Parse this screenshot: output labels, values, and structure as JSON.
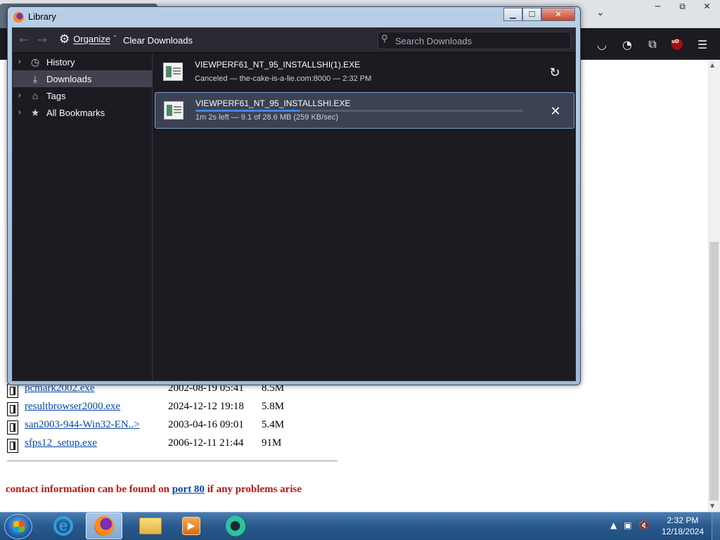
{
  "library": {
    "title": "Library",
    "window_controls": {
      "minimize": "▁",
      "maximize": "☐",
      "close": "✕"
    },
    "toolbar": {
      "back_icon": "←",
      "forward_icon": "→",
      "organize_label": "Organize",
      "organize_icon": "⚙",
      "organize_chevron": "ˇ",
      "clear_downloads_label": "Clear Downloads",
      "search_placeholder": "Search Downloads",
      "search_icon": "⚲"
    },
    "sidebar": {
      "items": [
        {
          "label": "History",
          "icon": "clock-icon",
          "glyph": "◷",
          "chevron": "›",
          "selected": false
        },
        {
          "label": "Downloads",
          "icon": "download-icon",
          "glyph": "⤓",
          "chevron": "",
          "selected": true
        },
        {
          "label": "Tags",
          "icon": "tag-icon",
          "glyph": "⌂",
          "chevron": "›",
          "selected": false
        },
        {
          "label": "All Bookmarks",
          "icon": "star-icon",
          "glyph": "★",
          "chevron": "›",
          "selected": false
        }
      ]
    },
    "downloads": [
      {
        "name": "VIEWPERF61_NT_95_INSTALLSHI(1).EXE",
        "status": "Canceled — the-cake-is-a-lie.com:8000 — 2:32 PM",
        "action_icon": "↻",
        "action": "retry",
        "progress": null
      },
      {
        "name": "VIEWPERF61_NT_95_INSTALLSHI.EXE",
        "status": "1m 2s left — 9.1 of 28.6 MB (259 KB/sec)",
        "action_icon": "✕",
        "action": "cancel",
        "progress": 0.32
      }
    ]
  },
  "page": {
    "files": [
      {
        "name": "pcmark2002.exe",
        "date": "2002-08-19 05:41",
        "size": "8.5M"
      },
      {
        "name": "resultbrowser2000.exe",
        "date": "2024-12-12 19:18",
        "size": "5.8M"
      },
      {
        "name": "san2003-944-Win32-EN..>",
        "date": "2003-04-16 09:01",
        "size": "5.4M"
      },
      {
        "name": "sfps12_setup.exe",
        "date": "2006-12-11 21:44",
        "size": "91M"
      }
    ],
    "contact": {
      "before": "contact information can be found on",
      "link": "port 80",
      "after": "if any problems arise"
    }
  },
  "browser": {
    "window_controls": {
      "minimize": "─",
      "maximize": "⧉",
      "close": "✕"
    },
    "toolbar_icons": [
      "pocket-icon",
      "sync-icon",
      "extensions-icon",
      "ublock-icon",
      "menu-icon"
    ],
    "ublock_label": "uD"
  },
  "taskbar": {
    "time": "2:32 PM",
    "date": "12/18/2024",
    "apps": [
      "internet-explorer",
      "firefox",
      "file-explorer",
      "media-player",
      "media-center"
    ]
  },
  "colors": {
    "accent": "#3f86e8",
    "contact_text": "#cc1111",
    "link": "#0645ad"
  }
}
